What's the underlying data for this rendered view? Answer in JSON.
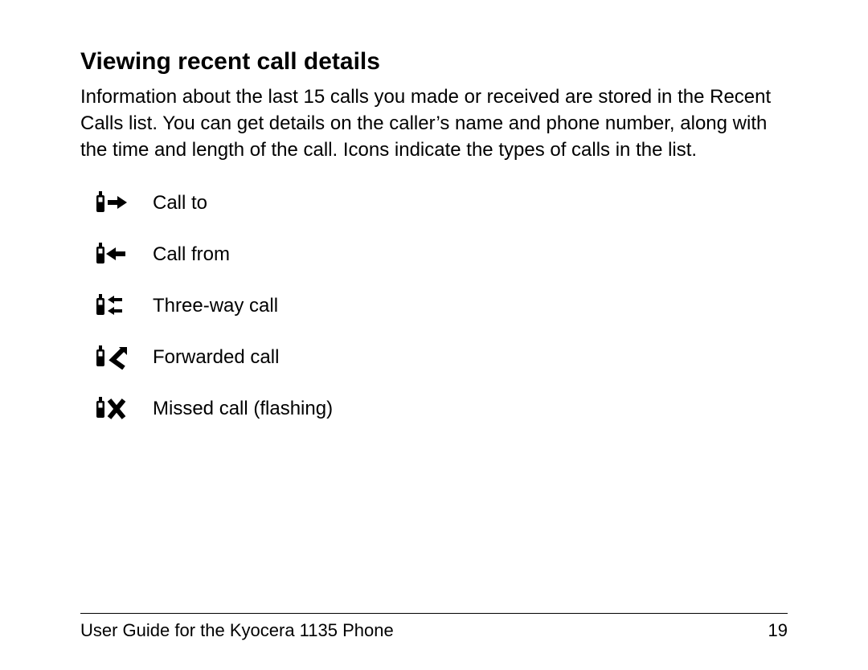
{
  "heading": "Viewing recent call details",
  "body": "Information about the last 15 calls you made or received are stored in the Recent Calls list. You can get details on the caller’s name and phone number, along with the time and length of the call. Icons indicate the types of calls in the list.",
  "icons": {
    "call_to": "Call to",
    "call_from": "Call from",
    "three_way": "Three-way call",
    "forwarded": "Forwarded call",
    "missed": "Missed call (flashing)"
  },
  "footer": {
    "title": "User Guide for the Kyocera 1135 Phone",
    "page": "19"
  }
}
